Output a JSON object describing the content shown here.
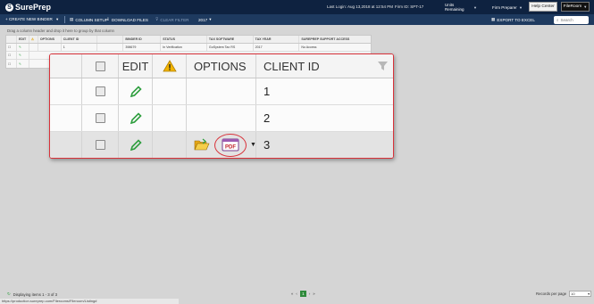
{
  "topbar": {
    "logo_text": "SurePrep",
    "logo_mark": "S",
    "last_login": "Last Login: Aug 13,2018 at 12:54 PM",
    "firm_id": "Firm ID: SPT-17",
    "units_select": "Units Remaining",
    "role_select": "Firm Preparer",
    "help_button": "Help Center",
    "filer_button": "FileRoom"
  },
  "toolbar": {
    "create_binder": "+ CREATE NEW BINDER",
    "column_setup": "COLUMN SETUP",
    "download_files": "DOWNLOAD FILES",
    "clear_filter": "CLEAR FILTER",
    "year": "2017",
    "export": "EXPORT TO EXCEL",
    "search_placeholder": "Search"
  },
  "grid_hint": "Drag a column header and drop it here to group by that column",
  "background_grid": {
    "headers": [
      "",
      "EDIT",
      "",
      "OPTIONS",
      "CLIENT ID",
      "",
      "BINDER ID",
      "STATUS",
      "TAX SOFTWARE",
      "TAX YEAR",
      "SUREPREP SUPPORT ACCESS"
    ],
    "rows": [
      [
        "",
        "",
        "",
        "",
        "1",
        "",
        "398679",
        "In Verification",
        "GoSystem Tax RS",
        "2017",
        "No Access"
      ]
    ]
  },
  "callout": {
    "headers": {
      "edit": "EDIT",
      "options": "OPTIONS",
      "client_id": "CLIENT ID"
    },
    "rows": [
      {
        "client_id": "1"
      },
      {
        "client_id": "2"
      },
      {
        "client_id": "3"
      }
    ],
    "pdf_label": "PDF"
  },
  "pager": {
    "displaying": "Displaying items 1 - 3 of 3",
    "current_page": "1",
    "records_per_page": "Records per page",
    "per_page_value": "10"
  },
  "statusbar_url": "https://production.sureprep.com/Filerooms/Fileroom/Listing#",
  "colors": {
    "topbar": "#0e2240",
    "toolbar": "#1e3a5f",
    "highlight": "#d8323a",
    "edit_green": "#2e9e3e"
  }
}
